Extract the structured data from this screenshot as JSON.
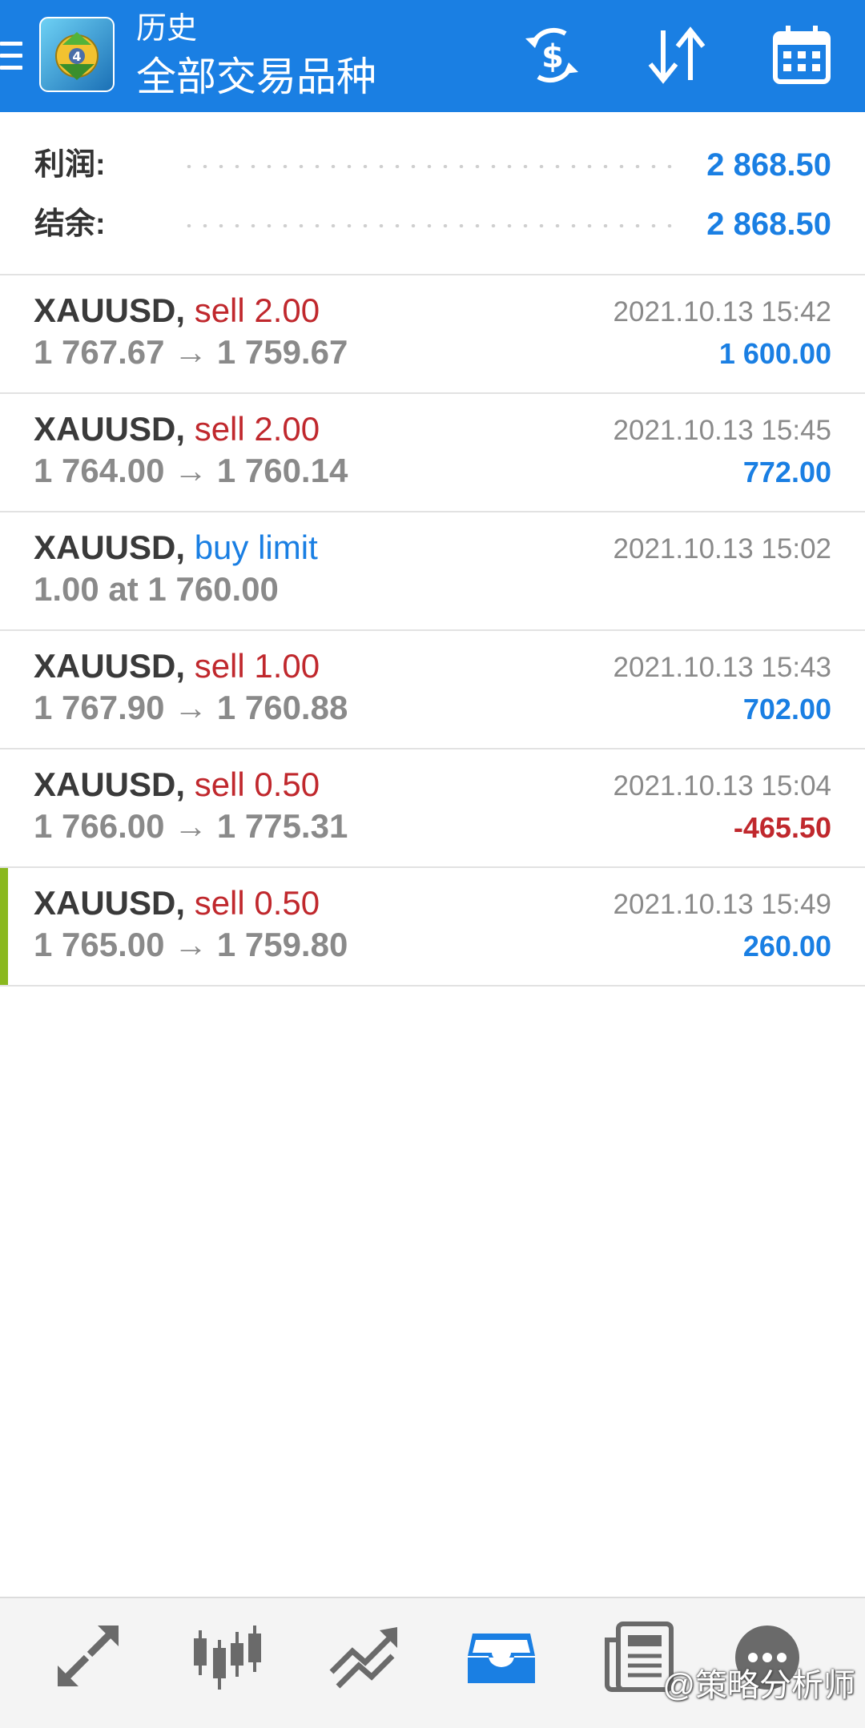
{
  "header": {
    "title_small": "历史",
    "title_big": "全部交易品种",
    "bg_color": "#1a7fe3",
    "icons": [
      "menu-icon",
      "app-logo",
      "currency-exchange-icon",
      "sort-icon",
      "calendar-icon"
    ]
  },
  "summary": {
    "profit_label": "利润:",
    "profit_value": "2 868.50",
    "balance_label": "结余:",
    "balance_value": "2 868.50"
  },
  "trades": [
    {
      "symbol": "XAUUSD,",
      "side": "sell 2.00",
      "prices": "1 767.67 → 1 759.67",
      "time": "2021.10.13 15:42",
      "profit": "1 600.00"
    },
    {
      "symbol": "XAUUSD,",
      "side": "sell 2.00",
      "prices": "1 764.00 → 1 760.14",
      "time": "2021.10.13 15:45",
      "profit": "772.00"
    },
    {
      "symbol": "XAUUSD,",
      "side": "buy limit",
      "prices": "1.00 at 1 760.00",
      "time": "2021.10.13 15:02",
      "profit": ""
    },
    {
      "symbol": "XAUUSD,",
      "side": "sell 1.00",
      "prices": "1 767.90 → 1 760.88",
      "time": "2021.10.13 15:43",
      "profit": "702.00"
    },
    {
      "symbol": "XAUUSD,",
      "side": "sell 0.50",
      "prices": "1 766.00 → 1 775.31",
      "time": "2021.10.13 15:04",
      "profit": "-465.50"
    },
    {
      "symbol": "XAUUSD,",
      "side": "sell 0.50",
      "prices": "1 765.00 → 1 759.80",
      "time": "2021.10.13 15:49",
      "profit": "260.00"
    }
  ],
  "colors": {
    "sell": "#c0282d",
    "buy": "#1a7fe3",
    "profit_pos": "#1a7fe3",
    "profit_neg": "#c0282d",
    "selected_marker": "#8ab81f"
  },
  "bottom_nav": {
    "items": [
      "quotes-icon",
      "chart-icon",
      "trade-icon",
      "history-icon",
      "news-icon",
      "chat-icon"
    ],
    "active": "history-icon"
  },
  "watermark": "@策略分析师"
}
